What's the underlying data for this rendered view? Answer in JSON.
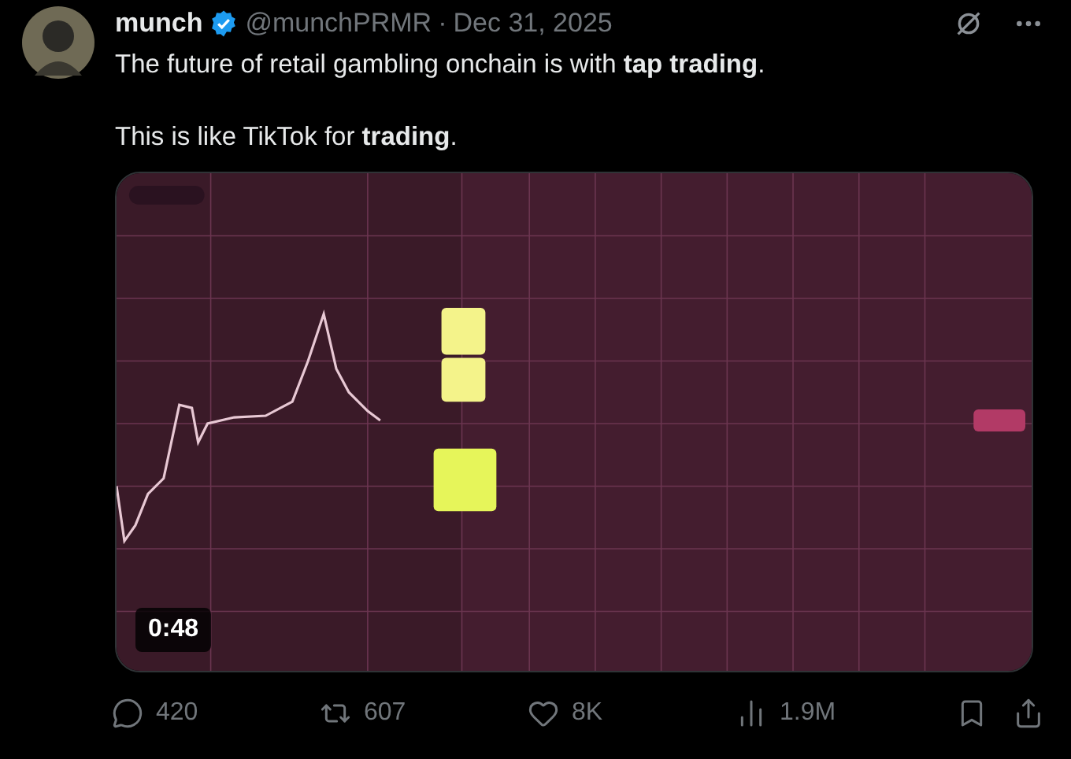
{
  "post": {
    "author": "munch",
    "verified": true,
    "handle": "@munchPRMR",
    "separator": "·",
    "date": "Dec 31, 2025",
    "paragraphs": [
      "The future of retail gambling onchain is with **tap trading**.",
      "This is like TikTok for **trading**."
    ],
    "media": {
      "kind": "picture",
      "duration": "0:48"
    },
    "actions": [
      {
        "kind": "reply",
        "count": "420"
      },
      {
        "kind": "repost",
        "count": "607"
      },
      {
        "kind": "like",
        "count": "8K"
      },
      {
        "kind": "views",
        "count": "1.9M"
      }
    ]
  }
}
